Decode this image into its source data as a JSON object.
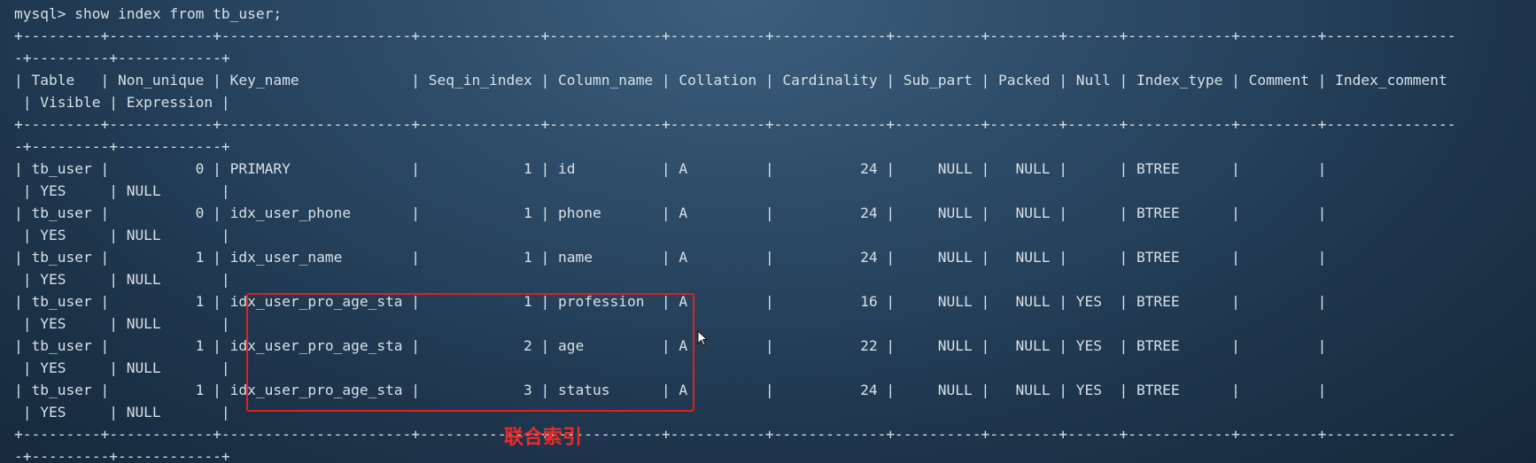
{
  "terminal": {
    "lines": [
      "mysql> show index from tb_user;",
      "+---------+------------+----------------------+--------------+-------------+-----------+-------------+----------+--------+------+------------+---------+---------------",
      "-+---------+------------+",
      "| Table   | Non_unique | Key_name             | Seq_in_index | Column_name | Collation | Cardinality | Sub_part | Packed | Null | Index_type | Comment | Index_comment",
      " | Visible | Expression |",
      "+---------+------------+----------------------+--------------+-------------+-----------+-------------+----------+--------+------+------------+---------+---------------",
      "-+---------+------------+",
      "| tb_user |          0 | PRIMARY              |            1 | id          | A         |          24 |     NULL |   NULL |      | BTREE      |         |",
      " | YES     | NULL       |",
      "| tb_user |          0 | idx_user_phone       |            1 | phone       | A         |          24 |     NULL |   NULL |      | BTREE      |         |",
      " | YES     | NULL       |",
      "| tb_user |          1 | idx_user_name        |            1 | name        | A         |          24 |     NULL |   NULL |      | BTREE      |         |",
      " | YES     | NULL       |",
      "| tb_user |          1 | idx_user_pro_age_sta |            1 | profession  | A         |          16 |     NULL |   NULL | YES  | BTREE      |         |",
      " | YES     | NULL       |",
      "| tb_user |          1 | idx_user_pro_age_sta |            2 | age         | A         |          22 |     NULL |   NULL | YES  | BTREE      |         |",
      " | YES     | NULL       |",
      "| tb_user |          1 | idx_user_pro_age_sta |            3 | status      | A         |          24 |     NULL |   NULL | YES  | BTREE      |         |",
      " | YES     | NULL       |",
      "+---------+------------+----------------------+--------------+-------------+-----------+-------------+----------+--------+------+------------+---------+---------------",
      "-+---------+------------+"
    ]
  },
  "annotation": {
    "label": "联合索引",
    "color": "#ee2a2a"
  },
  "theme": {
    "text_color": "#d7e0e8",
    "highlight_color": "#e02020"
  },
  "icons": {
    "cursor": "mouse-pointer-icon"
  }
}
